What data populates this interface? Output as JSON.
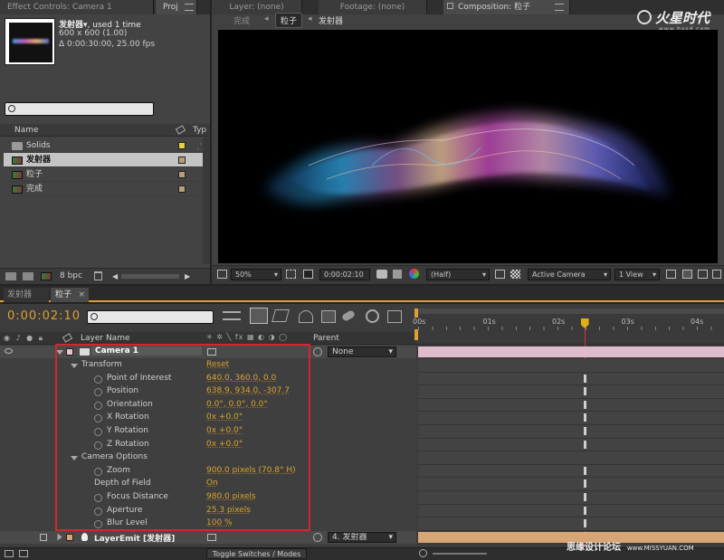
{
  "top_tabs": {
    "effect_controls": "Effect Controls: Camera 1",
    "project": "Proj",
    "layer": "Layer: (none)",
    "footage": "Footage: (none)",
    "composition": "Composition: 粒子"
  },
  "project_panel": {
    "item_name": "发射器",
    "used": ", used 1 time",
    "dims": "600 x 600 (1.00)",
    "duration": "Δ 0:00:30:00, 25.00 fps",
    "col_name": "Name",
    "col_type": "Typ",
    "items": [
      {
        "label": "Solids",
        "icon": "folder-icon",
        "color": "#e4d33a"
      },
      {
        "label": "发射器",
        "icon": "composition-icon",
        "color": "#b59e7a"
      },
      {
        "label": "粒子",
        "icon": "composition-icon",
        "color": "#b59e7a"
      },
      {
        "label": "完成",
        "icon": "composition-icon",
        "color": "#b59e7a"
      }
    ],
    "bpc": "8 bpc"
  },
  "comp_viewer": {
    "breadcrumbs": [
      "完成",
      "粒子",
      "发射器"
    ],
    "logo_text": "火星时代",
    "logo_url": "www.hxsd.com",
    "zoom": "50%",
    "timecode": "0:00:02:10",
    "resolution": "(Half)",
    "camera": "Active Camera",
    "view": "1 View"
  },
  "timeline": {
    "tabs": [
      "发射器",
      "粒子"
    ],
    "timecode": "0:00:02:10",
    "col_layer_name": "Layer Name",
    "col_parent": "Parent",
    "ruler": [
      "00s",
      "01s",
      "02s",
      "03s",
      "04s"
    ],
    "playhead_seconds": 2.4,
    "ruler_max_seconds": 4.28,
    "camera_layer": {
      "name": "Camera 1",
      "parent": "None"
    },
    "transform_label": "Transform",
    "transform_reset": "Reset",
    "transform_props": [
      {
        "name": "Point of Interest",
        "value": "640.0, 360.0, 0.0"
      },
      {
        "name": "Position",
        "value": "638.9, 934.0, -307.7"
      },
      {
        "name": "Orientation",
        "value": "0.0°, 0.0°, 0.0°"
      },
      {
        "name": "X Rotation",
        "value": "0x +0.0°"
      },
      {
        "name": "Y Rotation",
        "value": "0x +0.0°"
      },
      {
        "name": "Z Rotation",
        "value": "0x +0.0°"
      }
    ],
    "camera_options_label": "Camera Options",
    "camera_props": [
      {
        "name": "Zoom",
        "value": "900.0 pixels (70.8° H)",
        "stopwatch": true
      },
      {
        "name": "Depth of Field",
        "value": "On",
        "stopwatch": false
      },
      {
        "name": "Focus Distance",
        "value": "980.0 pixels",
        "stopwatch": true
      },
      {
        "name": "Aperture",
        "value": "25.3 pixels",
        "stopwatch": true
      },
      {
        "name": "Blur Level",
        "value": "100 %",
        "stopwatch": true
      }
    ],
    "emit_layer": {
      "name": "LayerEmit [发射器]",
      "parent": "4. 发射器"
    },
    "toggle_label": "Toggle Switches / Modes"
  },
  "watermark": "思缘设计论坛",
  "watermark_url": "www.MISSYUAN.COM",
  "colors": {
    "accent": "#d9a42b",
    "highlight_box": "#d0282c",
    "camera_row": "#e8c3d3",
    "emit_row": "#d6a676"
  }
}
